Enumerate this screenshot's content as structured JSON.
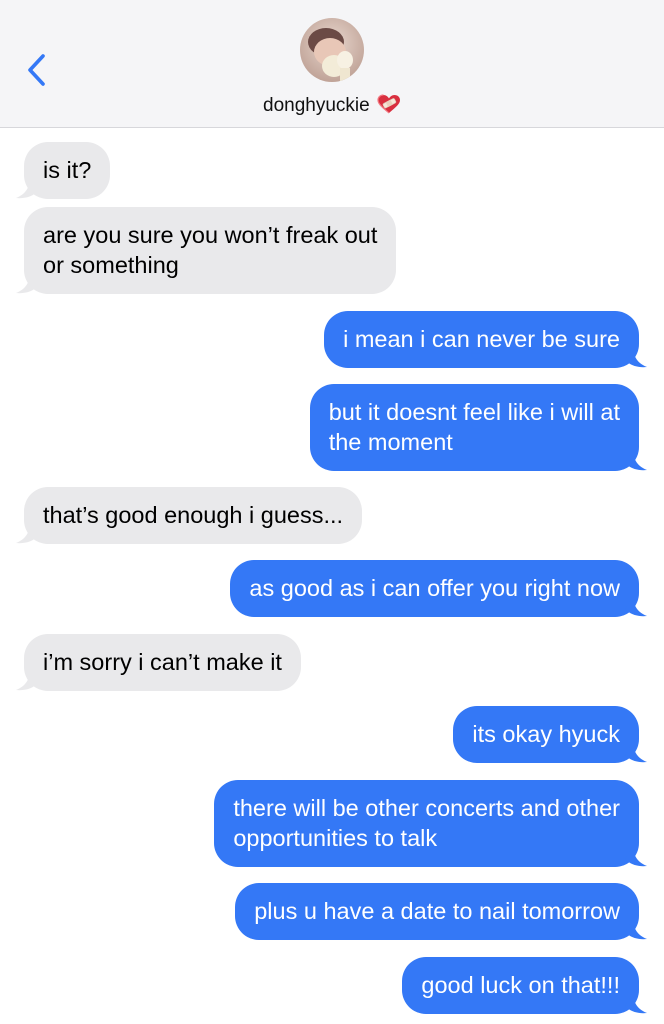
{
  "header": {
    "contact_name": "donghyuckie",
    "accent_color": "#3478f6",
    "back_icon": "chevron-left-icon",
    "status_emoji": "heart-with-bandage-icon"
  },
  "messages": [
    {
      "from": "them",
      "lines": [
        "is it?"
      ]
    },
    {
      "from": "them",
      "lines": [
        "are you sure you won’t freak out",
        "or something"
      ]
    },
    {
      "from": "me",
      "lines": [
        "i mean i can never be sure"
      ]
    },
    {
      "from": "me",
      "lines": [
        "but it doesnt feel like i will at",
        "the moment"
      ]
    },
    {
      "from": "them",
      "lines": [
        "that’s good enough i guess..."
      ]
    },
    {
      "from": "me",
      "lines": [
        "as good as i can offer you right now"
      ]
    },
    {
      "from": "them",
      "lines": [
        "i’m sorry i can’t make it"
      ]
    },
    {
      "from": "me",
      "lines": [
        "its okay hyuck"
      ]
    },
    {
      "from": "me",
      "lines": [
        "there will be other concerts and other",
        "opportunities to talk"
      ]
    },
    {
      "from": "me",
      "lines": [
        "plus u have a date to nail tomorrow"
      ]
    },
    {
      "from": "me",
      "lines": [
        "good luck on that!!!"
      ]
    }
  ]
}
